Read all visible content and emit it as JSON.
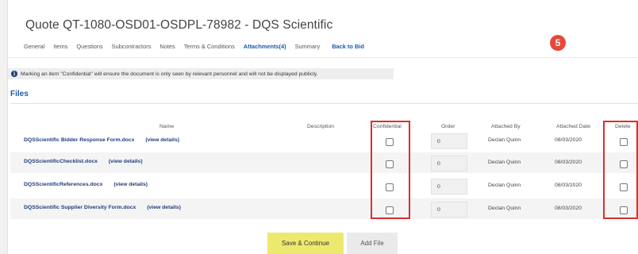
{
  "quote": {
    "title": "Quote QT-1080-OSD01-OSDPL-78982 - DQS Scientific"
  },
  "tabs": [
    {
      "label": "General"
    },
    {
      "label": "Items"
    },
    {
      "label": "Questions"
    },
    {
      "label": "Subcontractors"
    },
    {
      "label": "Notes"
    },
    {
      "label": "Terms & Conditions"
    },
    {
      "label": "Attachments(4)"
    },
    {
      "label": "Summary"
    },
    {
      "label": "Back to Bid"
    }
  ],
  "active_tab": "Attachments(4)",
  "step_badge": "5",
  "notice": {
    "icon": "info-icon",
    "text": "Marking an item \"Confidential\" will ensure the document is only seen by relevant personnel and will not be displayed publicly."
  },
  "files": {
    "heading": "Files",
    "columns": {
      "name": "Name",
      "description": "Description",
      "confidential": "Confidential",
      "order": "Order",
      "attached_by": "Attached By",
      "attached_date": "Attached Date",
      "delete": "Delete"
    },
    "rows": [
      {
        "name": "DQSScientific Bidder Response Form.docx",
        "details": "(view details)",
        "attached_by": "Declan Quinn",
        "attached_date": "08/03/2020",
        "order": "0"
      },
      {
        "name": "DQSScientificChecklist.docx",
        "details": "(view details)",
        "attached_by": "Declan Quinn",
        "attached_date": "08/03/2020",
        "order": "0"
      },
      {
        "name": "DQSScientificReferences.docx",
        "details": "(view details)",
        "attached_by": "Declan Quinn",
        "attached_date": "08/03/2020",
        "order": "0"
      },
      {
        "name": "DQSScientific Supplier Diversity Form.docx",
        "details": "(view details)",
        "attached_by": "Declan Quinn",
        "attached_date": "08/03/2020",
        "order": "0"
      }
    ]
  },
  "buttons": {
    "save": "Save & Continue",
    "add_file": "Add File"
  },
  "colors": {
    "accent": "#1f5aa6",
    "highlight": "#d9302c",
    "save_button": "#ede96e",
    "badge": "#e8473a"
  }
}
